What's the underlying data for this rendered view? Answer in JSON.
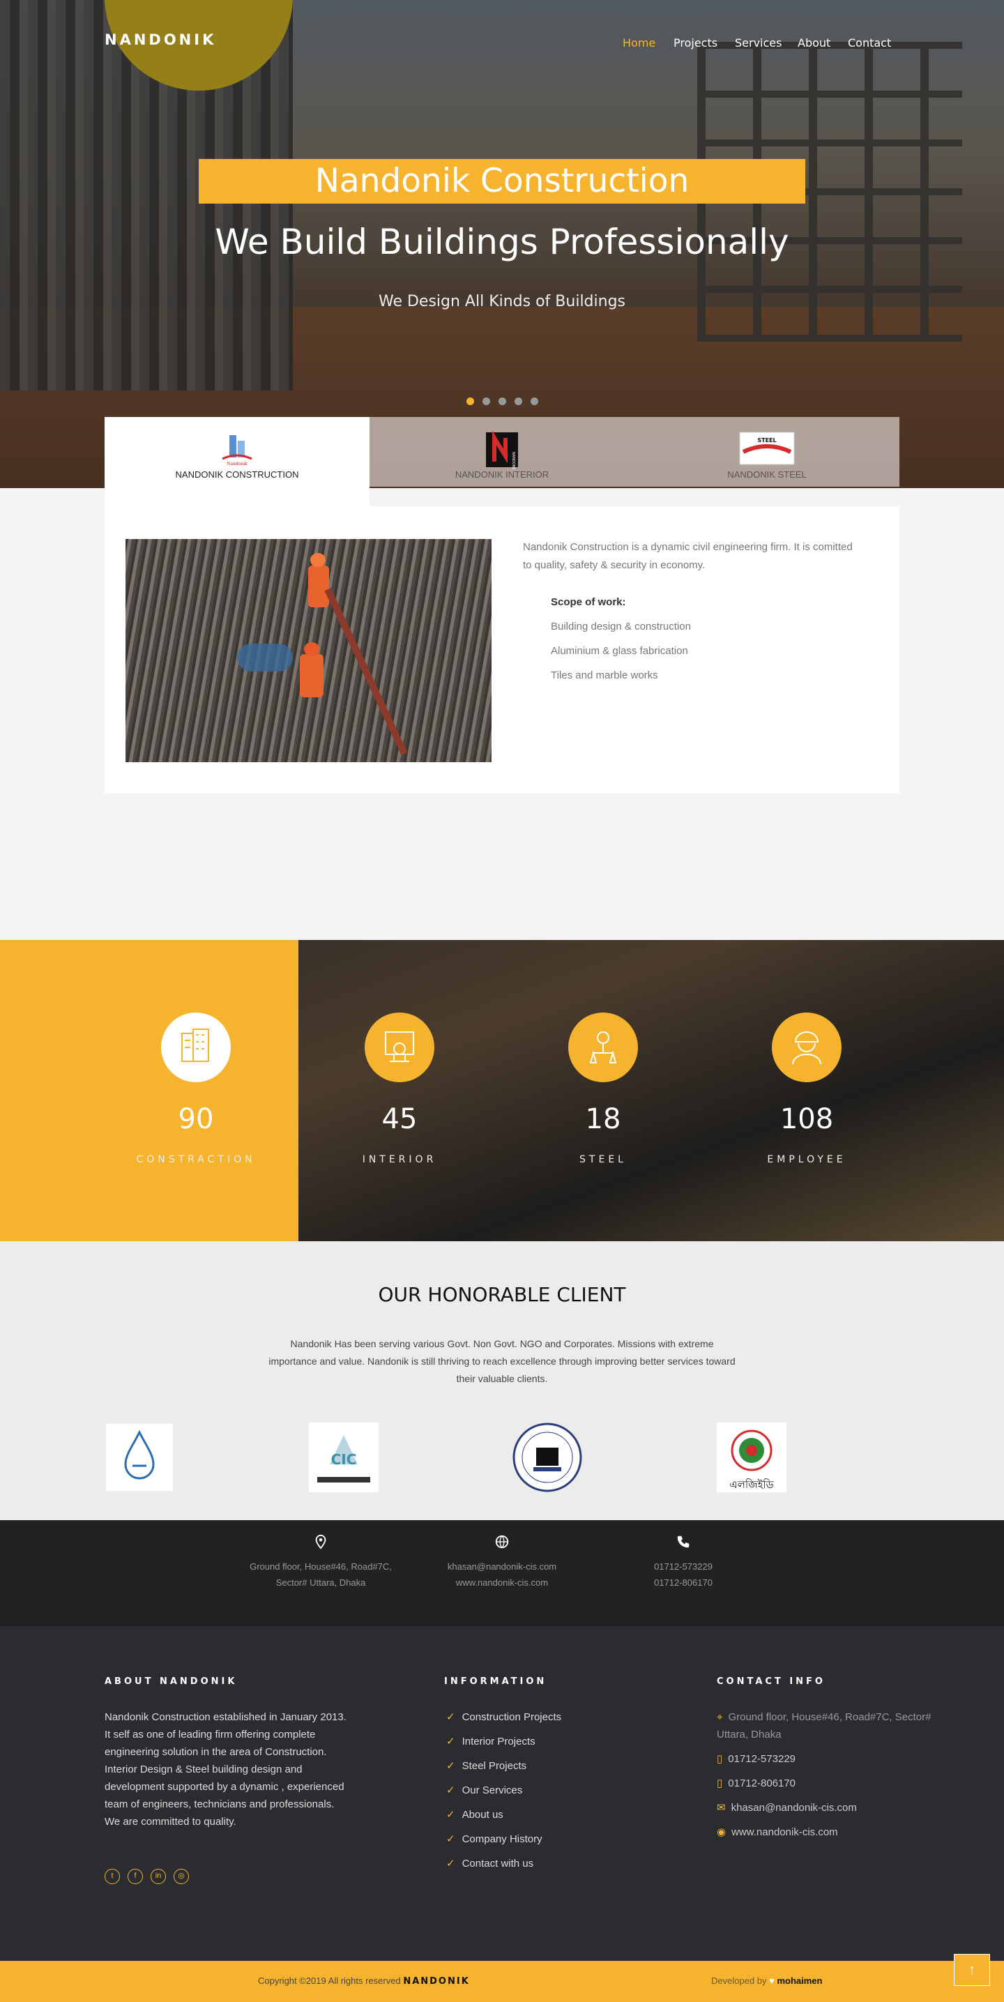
{
  "brand": {
    "logo": "NANDONIK",
    "accent": "#f6b32d"
  },
  "nav": [
    {
      "label": "Home",
      "active": true
    },
    {
      "label": "Projects"
    },
    {
      "label": "Services"
    },
    {
      "label": "About"
    },
    {
      "label": "Contact"
    }
  ],
  "hero": {
    "badge": "Nandonik Construction",
    "title": "We Build Buildings Professionally",
    "subtitle": "We Design All Kinds of Buildings",
    "slide_count": 5,
    "active_slide": 1
  },
  "tabs": [
    {
      "label": "NANDONIK CONSTRUCTION",
      "active": true
    },
    {
      "label": "NANDONIK INTERIOR"
    },
    {
      "label": "NANDONIK STEEL"
    }
  ],
  "about": {
    "intro": "Nandonik Construction is a dynamic civil engineering firm. It is comitted to quality, safety & security in economy.",
    "scope_heading": "Scope of work:",
    "scope": [
      "Building design & construction",
      "Aluminium & glass fabrication",
      "Tiles and marble works"
    ]
  },
  "stats": [
    {
      "icon": "building-icon",
      "value": "90",
      "label": "CONSTRACTION"
    },
    {
      "icon": "interior-icon",
      "value": "45",
      "label": "INTERIOR"
    },
    {
      "icon": "steel-icon",
      "value": "18",
      "label": "STEEL"
    },
    {
      "icon": "worker-icon",
      "value": "108",
      "label": "EMPLOYEE"
    }
  ],
  "clients": {
    "heading": "OUR HONORABLE CLIENT",
    "text": "Nandonik Has been serving various Govt. Non Govt. NGO and Corporates. Missions with extreme importance and value. Nandonik is still thriving to reach excellence through improving better services toward their valuable clients.",
    "logos": [
      "client-logo-water",
      "client-logo-cic",
      "client-logo-seal",
      "client-logo-lged"
    ],
    "lged_text": "এলজিইডি"
  },
  "strip": {
    "address": [
      "Ground floor, House#46, Road#7C,",
      "Sector# Uttara, Dhaka"
    ],
    "web": [
      "khasan@nandonik-cis.com",
      "www.nandonik-cis.com"
    ],
    "phone": [
      "01712-573229",
      "01712-806170"
    ]
  },
  "footer": {
    "about_heading": "ABOUT NANDONIK",
    "about_text": "Nandonik Construction established in January 2013. It self as one of leading firm offering complete engineering solution in the area of Construction. Interior Design & Steel building design and development supported by a dynamic , experienced team of engineers, technicians and professionals. We are committed to quality.",
    "info_heading": "INFORMATION",
    "links": [
      "Construction Projects",
      "Interior Projects",
      "Steel Projects",
      "Our Services",
      "About us",
      "Company History",
      "Contact with us"
    ],
    "contact_heading": "CONTACT INFO",
    "contact_address": "Ground floor, House#46, Road#7C, Sector# Uttara, Dhaka",
    "phone1": "01712-573229",
    "phone2": "01712-806170",
    "email": "khasan@nandonik-cis.com",
    "web": "www.nandonik-cis.com",
    "social": [
      "twitter-icon",
      "facebook-icon",
      "linkedin-icon",
      "dribbble-icon"
    ]
  },
  "bottom": {
    "copyright": "Copyright ©2019 All rights reserved",
    "copyright_brand": "NANDONIK",
    "dev_prefix": "Developed by",
    "dev_name": "mohaimen"
  }
}
